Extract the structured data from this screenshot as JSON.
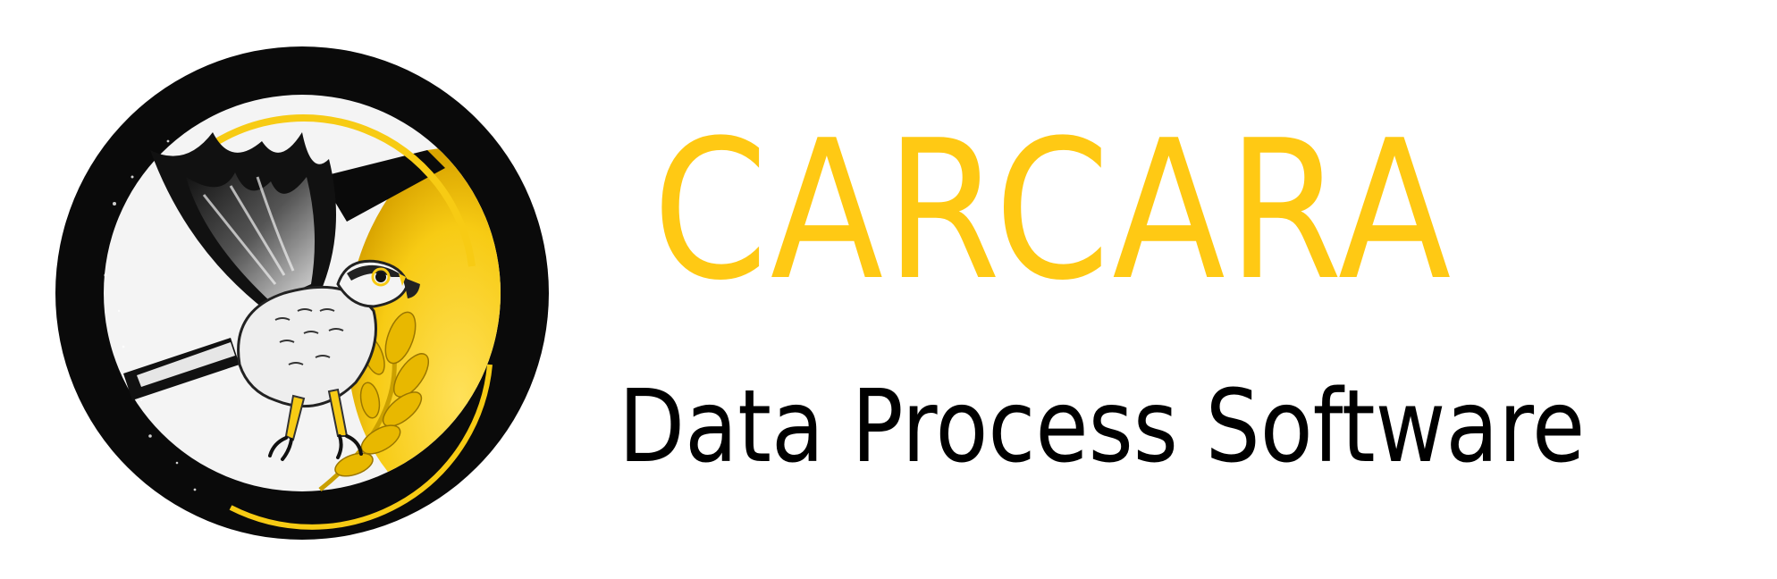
{
  "brand": {
    "name": "CARCARA",
    "tagline": "Data Process Software"
  },
  "colors": {
    "brand_yellow": "#FFC914",
    "tagline_text": "#000000",
    "background": "#FFFFFF",
    "emblem_ring": "#0A0A0A",
    "emblem_gold": "#FFD21F"
  },
  "icons": {
    "emblem": "falcon-emblem-icon"
  }
}
